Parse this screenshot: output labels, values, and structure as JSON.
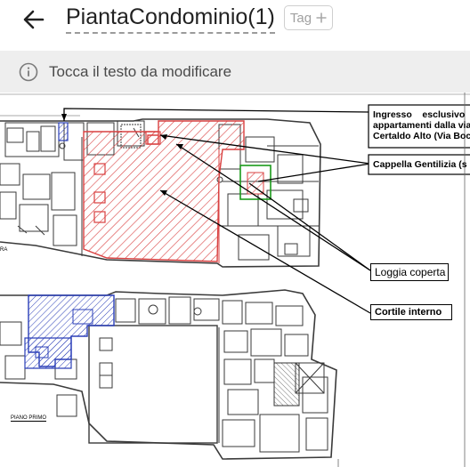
{
  "header": {
    "title": "PiantaCondominio(1)",
    "tag_label": "Tag",
    "back_icon": "arrow-left-icon",
    "tag_icon": "plus-icon"
  },
  "hint": {
    "icon": "info-circle-icon",
    "text": "Tocca il testo da modificare"
  },
  "plan": {
    "floor_label_ground": "RA",
    "floor_label_first": "PIANO PRIMO",
    "annotations": {
      "ingresso_line1": "Ingresso    esclusivo",
      "ingresso_line2": "appartamenti dalla via",
      "ingresso_line3": "Certaldo Alto (Via Boc",
      "cappella": "Cappella Gentilizia (s",
      "loggia": "Loggia coperta",
      "cortile": "Cortile interno"
    },
    "colors": {
      "red_hatch": "#d94040",
      "blue_hatch": "#2b3fb8",
      "green_outline": "#1a9a1a",
      "walls": "#3a3a3a"
    }
  }
}
